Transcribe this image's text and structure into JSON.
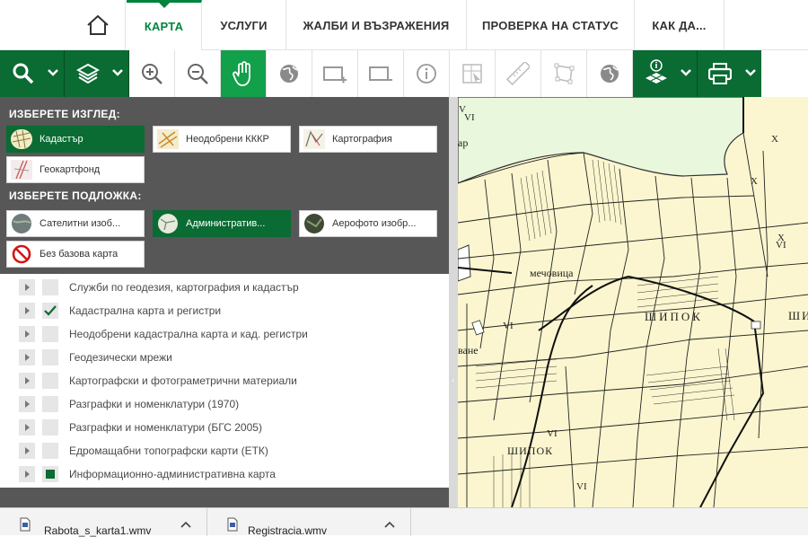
{
  "nav": {
    "tabs": [
      {
        "label": "КАРТА"
      },
      {
        "label": "УСЛУГИ"
      },
      {
        "label": "ЖАЛБИ И ВЪЗРАЖЕНИЯ"
      },
      {
        "label": "ПРОВЕРКА НА СТАТУС"
      },
      {
        "label": "КАК ДА..."
      }
    ],
    "active_tab": "КАРТА"
  },
  "colors": {
    "brand_dark": "#0a6b33",
    "brand_active": "#13a04a",
    "panel_bg": "#575757",
    "map_bg": "#fbf6cf",
    "map_green_area": "#e9f7dc"
  },
  "toolbar": {
    "icons": [
      "search-icon",
      "layers-icon",
      "zoom-in-icon",
      "zoom-out-icon",
      "hand-pan-icon",
      "globe-icon",
      "add-rectangle-icon",
      "remove-rectangle-icon",
      "info-icon",
      "select-parcel-icon",
      "ruler-icon",
      "area-measure-icon",
      "globe-icon",
      "layer-info-icon",
      "print-icon"
    ]
  },
  "view": {
    "title": "ИЗБЕРЕТЕ ИЗГЛЕД:",
    "options": [
      {
        "label": "Кадастър",
        "selected": true
      },
      {
        "label": "Неодобрени КККР",
        "selected": false
      },
      {
        "label": "Картография",
        "selected": false
      },
      {
        "label": "Геокартфонд",
        "selected": false
      }
    ]
  },
  "base": {
    "title": "ИЗБЕРЕТЕ ПОДЛОЖКА:",
    "options": [
      {
        "label": "Сателитни изоб...",
        "selected": false
      },
      {
        "label": "Административ...",
        "selected": true
      },
      {
        "label": "Аерофото изобр...",
        "selected": false
      },
      {
        "label": "Без базова карта",
        "selected": false
      }
    ]
  },
  "layers": [
    {
      "label": "Служби по геодезия, картография и кадастър",
      "state": "unchecked"
    },
    {
      "label": "Кадастрална карта и регистри",
      "state": "checked"
    },
    {
      "label": "Неодобрени кадастрална карта и кад. регистри",
      "state": "unchecked"
    },
    {
      "label": "Геодезически мрежи",
      "state": "unchecked"
    },
    {
      "label": "Картографски и фотограметрични материали",
      "state": "unchecked"
    },
    {
      "label": "Разграфки и номенклатури (1970)",
      "state": "unchecked"
    },
    {
      "label": "Разграфки и номенклатури (БГС 2005)",
      "state": "unchecked"
    },
    {
      "label": "Едромащабни топографски карти (ЕТК)",
      "state": "unchecked"
    },
    {
      "label": "Информационно-административна карта",
      "state": "partial"
    }
  ],
  "map": {
    "labels": [
      "мечовица",
      "ШИПОК",
      "ШИПОК",
      "ШИ",
      "ване",
      "ар"
    ],
    "roman": [
      "V",
      "VI",
      "X",
      "X",
      "X",
      "VI",
      "VI",
      "VI",
      "VI"
    ]
  },
  "downloads": [
    {
      "name": "Rabota_s_karta1.wmv"
    },
    {
      "name": "Registracia.wmv"
    }
  ]
}
